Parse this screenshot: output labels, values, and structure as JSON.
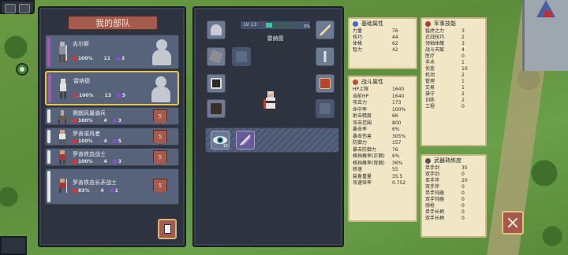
{
  "left_panel": {
    "title": "我的部队",
    "units": [
      {
        "name": "吉尔斯",
        "hp": "100%",
        "atk": "11",
        "sp": "3",
        "bar": "#a05ab4",
        "badge": ""
      },
      {
        "name": "雷纳德",
        "hp": "100%",
        "atk": "13",
        "sp": "5",
        "bar": "#a05ab4",
        "badge": ""
      },
      {
        "name": "赛朗风暴骑兵",
        "hp": "100%",
        "atk": "4",
        "sp": "3",
        "bar": "#e8e8e8",
        "badge": "5"
      },
      {
        "name": "罗善诺风者",
        "hp": "100%",
        "atk": "4",
        "sp": "5",
        "bar": "#e8e8e8",
        "badge": "5"
      },
      {
        "name": "罗善铁血战士",
        "hp": "100%",
        "atk": "4",
        "sp": "3",
        "bar": "#e8e8e8",
        "badge": "5"
      },
      {
        "name": "罗善铁血长矛战士",
        "hp": "83%",
        "atk": "4",
        "sp": "1",
        "bar": "#e8e8e8",
        "badge": "5"
      }
    ]
  },
  "detail": {
    "level": "LV 13",
    "xp_pct": "5%",
    "unit_name": "雷纳德",
    "skill_levels": [
      "10",
      ""
    ]
  },
  "basic_attrs": {
    "title": "基础属性",
    "rows": [
      {
        "k": "力量",
        "v": "76"
      },
      {
        "k": "技巧",
        "v": "44"
      },
      {
        "k": "体格",
        "v": "62"
      },
      {
        "k": "智力",
        "v": "42"
      }
    ]
  },
  "combat_attrs": {
    "title": "战斗属性",
    "rows": [
      {
        "k": "HP上限",
        "v": "1640"
      },
      {
        "k": "当前HP",
        "v": "1640"
      },
      {
        "k": "攻击力",
        "v": "173"
      },
      {
        "k": "命中率",
        "v": "100%"
      },
      {
        "k": "射击精度",
        "v": "66"
      },
      {
        "k": "攻击范围",
        "v": "800"
      },
      {
        "k": "暴击率",
        "v": "6%"
      },
      {
        "k": "暴击伤害",
        "v": "305%"
      },
      {
        "k": "防御力",
        "v": "157"
      },
      {
        "k": "暴击防御力",
        "v": "76"
      },
      {
        "k": "格挡概率(正面)",
        "v": "6%"
      },
      {
        "k": "格挡概率(背面)",
        "v": "36%"
      },
      {
        "k": "移速",
        "v": "55"
      },
      {
        "k": "装备重量",
        "v": "35.5"
      },
      {
        "k": "攻速倍率",
        "v": "0.752"
      }
    ]
  },
  "military_skills": {
    "title": "军事技能",
    "rows": [
      {
        "k": "猛虎之力",
        "v": "3"
      },
      {
        "k": "近战技巧",
        "v": "2"
      },
      {
        "k": "领袖体魄",
        "v": "3"
      },
      {
        "k": "战斗天赋",
        "v": "4"
      },
      {
        "k": "医疗",
        "v": "0"
      },
      {
        "k": "手术",
        "v": "1"
      },
      {
        "k": "侦查",
        "v": "10"
      },
      {
        "k": "机动",
        "v": "2"
      },
      {
        "k": "管理",
        "v": "1"
      },
      {
        "k": "交易",
        "v": "1"
      },
      {
        "k": "操守",
        "v": "2"
      },
      {
        "k": "训练",
        "v": "2"
      },
      {
        "k": "工程",
        "v": "0"
      }
    ]
  },
  "weapon_prof": {
    "title": "武器熟练度",
    "rows": [
      {
        "k": "单手剑",
        "v": "35"
      },
      {
        "k": "双手剑",
        "v": "0"
      },
      {
        "k": "单手斧",
        "v": "20"
      },
      {
        "k": "双手斧",
        "v": "0"
      },
      {
        "k": "单手钝器",
        "v": "0"
      },
      {
        "k": "双手钝器",
        "v": "0"
      },
      {
        "k": "骑枪",
        "v": "0"
      },
      {
        "k": "单手长柄",
        "v": "0"
      },
      {
        "k": "双手长柄",
        "v": "0"
      }
    ]
  },
  "colors": {
    "accent_select": "#e6c34a",
    "panel_bg": "#2e3340",
    "stat_bg": "#f1e6c6",
    "button": "#a45a4c"
  }
}
